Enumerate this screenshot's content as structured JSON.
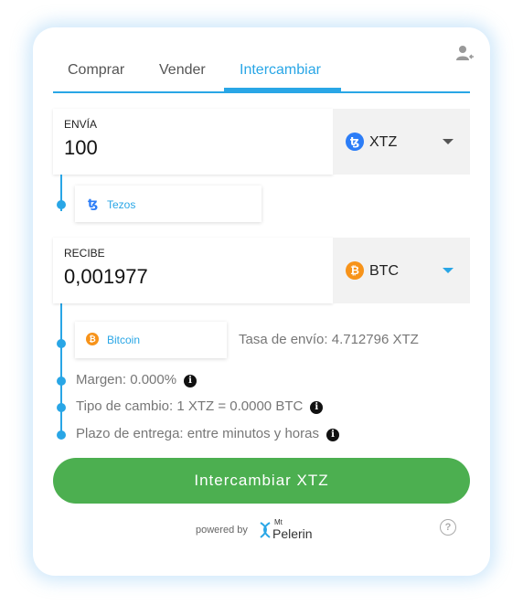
{
  "tabs": [
    {
      "label": "Comprar",
      "active": false
    },
    {
      "label": "Vender",
      "active": false
    },
    {
      "label": "Intercambiar",
      "active": true
    }
  ],
  "send": {
    "label": "ENVÍA",
    "amount": "100",
    "currency": "XTZ",
    "currency_icon": "tezos-icon",
    "network": "Tezos"
  },
  "receive": {
    "label": "RECIBE",
    "amount": "0,001977",
    "currency": "BTC",
    "currency_icon": "bitcoin-icon",
    "network": "Bitcoin"
  },
  "fees": {
    "send_rate": "Tasa de envío: 4.712796 XTZ",
    "margin": "Margen: 0.000%",
    "exchange_rate": "Tipo de cambio: 1 XTZ = 0.0000 BTC",
    "delivery": "Plazo de entrega: entre minutos y horas"
  },
  "action": {
    "label": "Intercambiar XTZ"
  },
  "footer": {
    "powered_by": "powered by",
    "brand_small": "Mt",
    "brand": "Pelerin"
  },
  "colors": {
    "accent": "#29a6e6",
    "button": "#4caf50",
    "tezos": "#2c7df7",
    "bitcoin": "#f7931a"
  }
}
